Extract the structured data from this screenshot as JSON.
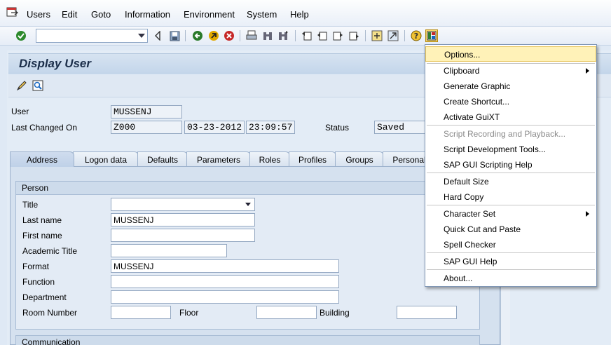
{
  "menubar": {
    "items": [
      {
        "label": "Users"
      },
      {
        "label": "Edit"
      },
      {
        "label": "Goto"
      },
      {
        "label": "Information"
      },
      {
        "label": "Environment"
      },
      {
        "label": "System"
      },
      {
        "label": "Help"
      }
    ]
  },
  "toolbar": {
    "command_value": ""
  },
  "screen": {
    "title": "Display User"
  },
  "header": {
    "user_label": "User",
    "user_value": "MUSSENJ",
    "last_changed_label": "Last Changed On",
    "last_changed_by": "Z000",
    "last_changed_date": "03-23-2012",
    "last_changed_time": "23:09:57",
    "status_label": "Status",
    "status_value": "Saved"
  },
  "tabs": [
    {
      "label": "Address"
    },
    {
      "label": "Logon data"
    },
    {
      "label": "Defaults"
    },
    {
      "label": "Parameters"
    },
    {
      "label": "Roles"
    },
    {
      "label": "Profiles"
    },
    {
      "label": "Groups"
    },
    {
      "label": "Personal"
    }
  ],
  "person": {
    "heading": "Person",
    "title_label": "Title",
    "title_value": "",
    "last_name_label": "Last name",
    "last_name_value": "MUSSENJ",
    "first_name_label": "First name",
    "first_name_value": "",
    "academic_title_label": "Academic Title",
    "academic_title_value": "",
    "format_label": "Format",
    "format_value": "MUSSENJ",
    "function_label": "Function",
    "function_value": "",
    "department_label": "Department",
    "department_value": "",
    "room_label": "Room Number",
    "room_value": "",
    "floor_label": "Floor",
    "floor_value": "",
    "building_label": "Building",
    "building_value": ""
  },
  "communication": {
    "heading": "Communication"
  },
  "popup_menu": {
    "items": [
      {
        "label": "Options..."
      },
      {
        "label": "Clipboard"
      },
      {
        "label": "Generate Graphic"
      },
      {
        "label": "Create Shortcut..."
      },
      {
        "label": "Activate GuiXT"
      },
      {
        "label": "Script Recording and Playback..."
      },
      {
        "label": "Script Development Tools..."
      },
      {
        "label": "SAP GUI Scripting Help"
      },
      {
        "label": "Default Size"
      },
      {
        "label": "Hard Copy"
      },
      {
        "label": "Character Set"
      },
      {
        "label": "Quick Cut and Paste"
      },
      {
        "label": "Spell Checker"
      },
      {
        "label": "SAP GUI Help"
      },
      {
        "label": "About..."
      }
    ]
  },
  "colors": {
    "highlight": "#fff2b8",
    "accent": "#1b2e4a"
  }
}
